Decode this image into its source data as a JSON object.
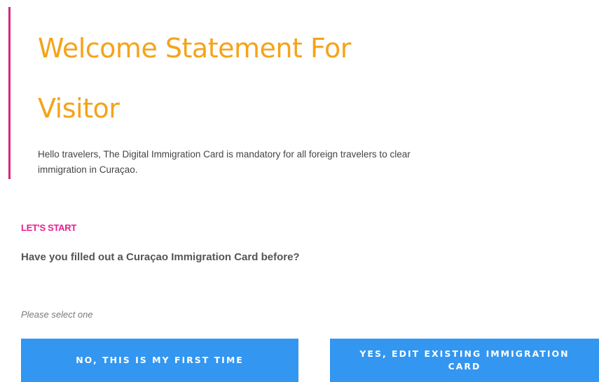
{
  "welcome": {
    "title": "Welcome Statement For Visitor",
    "text": "Hello travelers, The Digital Immigration Card is mandatory for all foreign travelers to clear immigration in Curaçao."
  },
  "form": {
    "section_label": "LET'S START",
    "question": "Have you filled out a Curaçao Immigration Card before?",
    "hint": "Please select one",
    "options": [
      {
        "label": "NO, THIS IS MY FIRST TIME"
      },
      {
        "label": "YES, EDIT EXISTING IMMIGRATION CARD"
      }
    ]
  },
  "colors": {
    "title": "#f5a31a",
    "accent_bar": "#d6267f",
    "section_label": "#e6208c",
    "button": "#3396f0"
  }
}
